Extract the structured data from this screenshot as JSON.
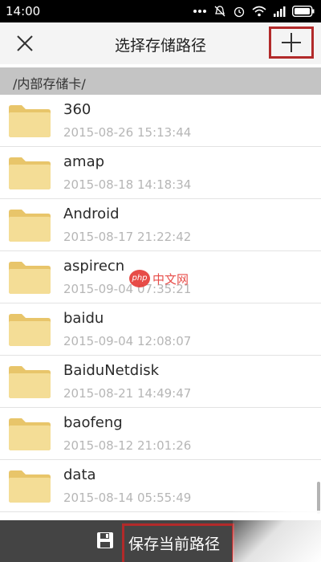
{
  "status_bar": {
    "time": "14:00"
  },
  "header": {
    "title": "选择存储路径",
    "close_icon": "close-icon",
    "add_icon": "plus-icon"
  },
  "path": {
    "current": "/内部存储卡/"
  },
  "files": [
    {
      "name": "360",
      "date": "2015-08-26 15:13:44"
    },
    {
      "name": "amap",
      "date": "2015-08-18 14:18:34"
    },
    {
      "name": "Android",
      "date": "2015-08-17 21:22:42"
    },
    {
      "name": "aspirecn",
      "date": "2015-09-04 07:35:21"
    },
    {
      "name": "baidu",
      "date": "2015-09-04 12:08:07"
    },
    {
      "name": "BaiduNetdisk",
      "date": "2015-08-21 14:49:47"
    },
    {
      "name": "baofeng",
      "date": "2015-08-12 21:01:26"
    },
    {
      "name": "data",
      "date": "2015-08-14 05:55:49"
    }
  ],
  "watermark": {
    "badge": "php",
    "text": "中文网"
  },
  "footer": {
    "save_label": "保存当前路径",
    "save_icon": "floppy-disk-icon"
  },
  "colors": {
    "highlight": "#b22a2a",
    "folder": "#f2d98d",
    "footer_bg": "#444444",
    "path_bg": "#c4c4c4"
  }
}
